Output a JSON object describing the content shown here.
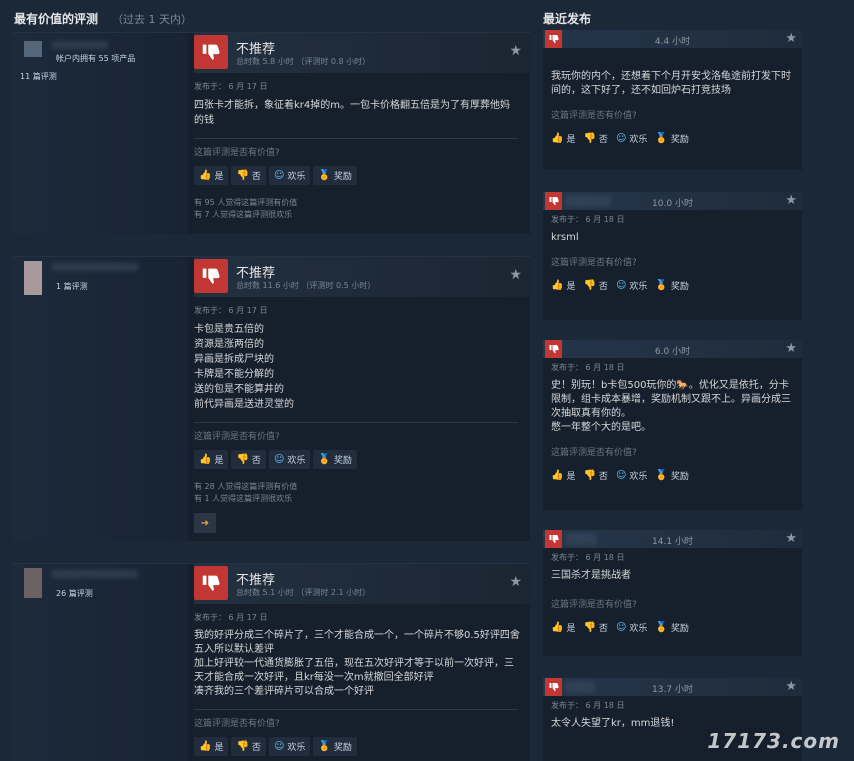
{
  "headers": {
    "most_helpful": "最有价值的评测",
    "most_helpful_sub": "（过去 1 天内）",
    "recent": "最近发布"
  },
  "common": {
    "not_recommended": "不推荐",
    "helpful_question": "这篇评测是否有价值?",
    "yes": "是",
    "no": "否",
    "funny": "欢乐",
    "award": "奖励"
  },
  "colors": {
    "thumb_down_bg": "#c23734",
    "accent": "#67c1f5",
    "award": "#e4b53c"
  },
  "reviews": [
    {
      "owned": "帐户内拥有 55 项产品",
      "review_count": "11 篇评测",
      "hours": "总时数 5.8 小时 （评测时 0.8 小时）",
      "posted": "发布于： 6 月 17 日",
      "text": "四张卡才能拆，象征着kr4掉的m。一包卡价格翻五倍是为了有厚葬他妈的钱",
      "helpful_count": "有 95 人觉得这篇评测有价值",
      "funny_count": "有 7 人觉得这篇评测很欢乐"
    },
    {
      "review_count": "1 篇评测",
      "hours": "总时数 11.6 小时 （评测时 0.5 小时）",
      "posted": "发布于： 6 月 17 日",
      "text": "卡包是贵五倍的\n资源是涨两倍的\n异画是拆成尸块的\n卡牌是不能分解的\n送的包是不能算井的\n前代异画是送进灵堂的",
      "helpful_count": "有 28 人觉得这篇评测有价值",
      "funny_count": "有 1 人觉得这篇评测很欢乐"
    },
    {
      "review_count": "26 篇评测",
      "hours": "总时数 5.1 小时 （评测时 2.1 小时）",
      "posted": "发布于： 6 月 17 日",
      "text": "我的好评分成三个碎片了，三个才能合成一个，一个碎片不够0.5好评四舍五入所以默认差评\n加上好评较一代通货膨胀了五倍，现在五次好评才等于以前一次好评，三天才能合成一次好评，且kr每没一次m就撤回全部好评\n凑齐我的三个差评碎片可以合成一个好评"
    }
  ],
  "recent": [
    {
      "hours": "4.4 小时",
      "text": "我玩你的内个，还想着下个月开安戈洛龟途前打发下时间的，这下好了，还不如回炉石打竞技场"
    },
    {
      "hours": "10.0 小时",
      "posted": "发布于： 6 月 18 日",
      "text": "krsml"
    },
    {
      "hours": "6.0 小时",
      "posted": "发布于： 6 月 18 日",
      "text": "史！别玩！b卡包500玩你的🐎。优化又是依托，分卡限制，组卡成本暴增，奖励机制又跟不上。异画分成三次抽取真有你的。\n憋一年整个大的是吧。"
    },
    {
      "hours": "14.1 小时",
      "posted": "发布于： 6 月 18 日",
      "text": "三国杀才是挑战者"
    },
    {
      "hours": "13.7 小时",
      "posted": "发布于： 6 月 18 日",
      "text": "太令人失望了kr，mm退钱!"
    }
  ],
  "watermark": "17173.com"
}
